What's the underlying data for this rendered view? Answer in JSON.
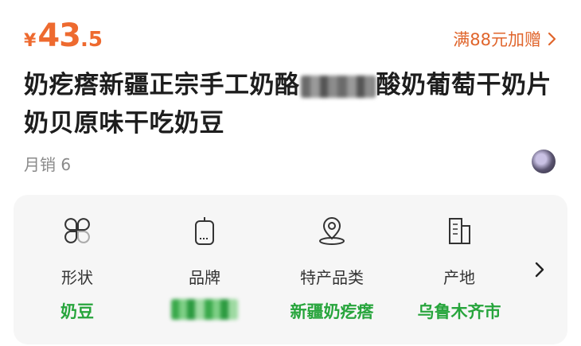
{
  "price": {
    "symbol": "¥",
    "integer": "43",
    "decimal": ".5"
  },
  "promo": {
    "label": "满88元加赠"
  },
  "title": {
    "part1": "奶疙瘩新疆正宗手工奶酪",
    "part2": "酸奶葡萄干奶片奶贝原味干吃奶豆"
  },
  "sales": {
    "label": "月销 6"
  },
  "attributes": [
    {
      "label": "形状",
      "value": "奶豆",
      "icon": "clover-icon"
    },
    {
      "label": "品牌",
      "value": "",
      "icon": "tag-icon"
    },
    {
      "label": "特产品类",
      "value": "新疆奶疙瘩",
      "icon": "location-icon"
    },
    {
      "label": "产地",
      "value": "乌鲁木齐市",
      "icon": "building-icon"
    }
  ],
  "colors": {
    "price": "#ee6a2f",
    "accent_value": "#27a53c",
    "card_bg": "#f6f6f6"
  }
}
